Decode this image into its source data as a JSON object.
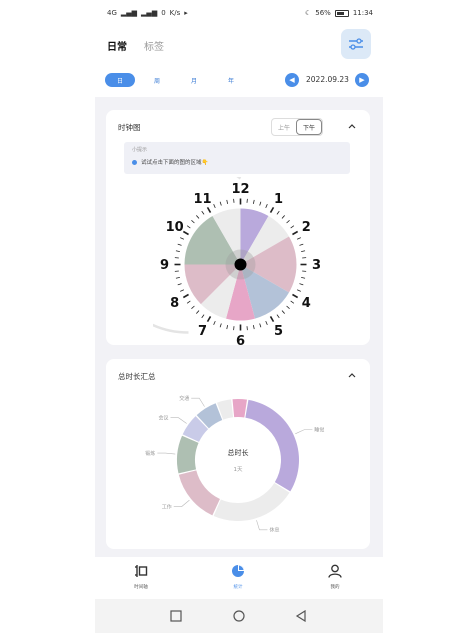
{
  "status_bar": {
    "network": "4G",
    "speed": "0",
    "speed_unit": "K/s",
    "battery": "56%",
    "time": "11:34"
  },
  "header": {
    "tabs": [
      {
        "label": "日常",
        "active": true
      },
      {
        "label": "标签",
        "active": false
      }
    ]
  },
  "date_bar": {
    "periods": [
      {
        "label": "日",
        "active": true
      },
      {
        "label": "周",
        "active": false
      },
      {
        "label": "月",
        "active": false
      },
      {
        "label": "年",
        "active": false
      }
    ],
    "date": "2022.09.23",
    "prev_icon": "chevron-left-icon",
    "next_icon": "chevron-right-icon"
  },
  "clock_card": {
    "title": "时钟图",
    "am_label": "上午",
    "pm_label": "下午",
    "selected": "下午",
    "tip_title": "小提示",
    "tip_text": "试试点击下面的图的区域👇"
  },
  "summary_card": {
    "title": "总时长汇总",
    "center_title": "总时长",
    "center_value": "1天"
  },
  "chart_data": [
    {
      "type": "pie",
      "title": "",
      "hours": [
        "12",
        "1",
        "2",
        "3",
        "4",
        "5",
        "6",
        "7",
        "8",
        "9",
        "10",
        "11"
      ],
      "slices": [
        {
          "hour_start": 12,
          "hour_end": 1,
          "color": "#b9a9dc"
        },
        {
          "hour_start": 1,
          "hour_end": 2,
          "color": "#ececec"
        },
        {
          "hour_start": 2,
          "hour_end": 4,
          "color": "#ddbcc8"
        },
        {
          "hour_start": 4,
          "hour_end": 5.5,
          "color": "#b3c2d8"
        },
        {
          "hour_start": 5.5,
          "hour_end": 6.5,
          "color": "#e7a6c7"
        },
        {
          "hour_start": 6.5,
          "hour_end": 7.5,
          "color": "#ececec"
        },
        {
          "hour_start": 7.5,
          "hour_end": 9,
          "color": "#ddbcc8"
        },
        {
          "hour_start": 9,
          "hour_end": 11,
          "color": "#aebfb2"
        },
        {
          "hour_start": 11,
          "hour_end": 12,
          "color": "#ececec"
        }
      ]
    },
    {
      "type": "pie",
      "title": "总时长",
      "slices": [
        {
          "label": "睡觉",
          "value": 7.5,
          "color": "#b9a9dc"
        },
        {
          "label": "休息",
          "value": 5.5,
          "color": "#ececec"
        },
        {
          "label": "工作",
          "value": 3.5,
          "color": "#ddbcc8"
        },
        {
          "label": "锻炼",
          "value": 2.5,
          "color": "#aebfb2"
        },
        {
          "label": "会议",
          "value": 1.5,
          "color": "#c9cbe8"
        },
        {
          "label": "交通",
          "value": 1.5,
          "color": "#b3c2d8"
        },
        {
          "label": "",
          "value": 1,
          "color": "#ececec"
        },
        {
          "label": "",
          "value": 1,
          "color": "#e7a6c7"
        }
      ]
    }
  ],
  "bottom_nav": {
    "items": [
      {
        "label": "时间轴",
        "icon": "timeline-icon",
        "active": false
      },
      {
        "label": "统计",
        "icon": "pie-chart-icon",
        "active": true
      },
      {
        "label": "我的",
        "icon": "user-icon",
        "active": false
      }
    ]
  },
  "system_nav": {
    "items": [
      "square-icon",
      "circle-icon",
      "back-triangle-icon"
    ]
  }
}
